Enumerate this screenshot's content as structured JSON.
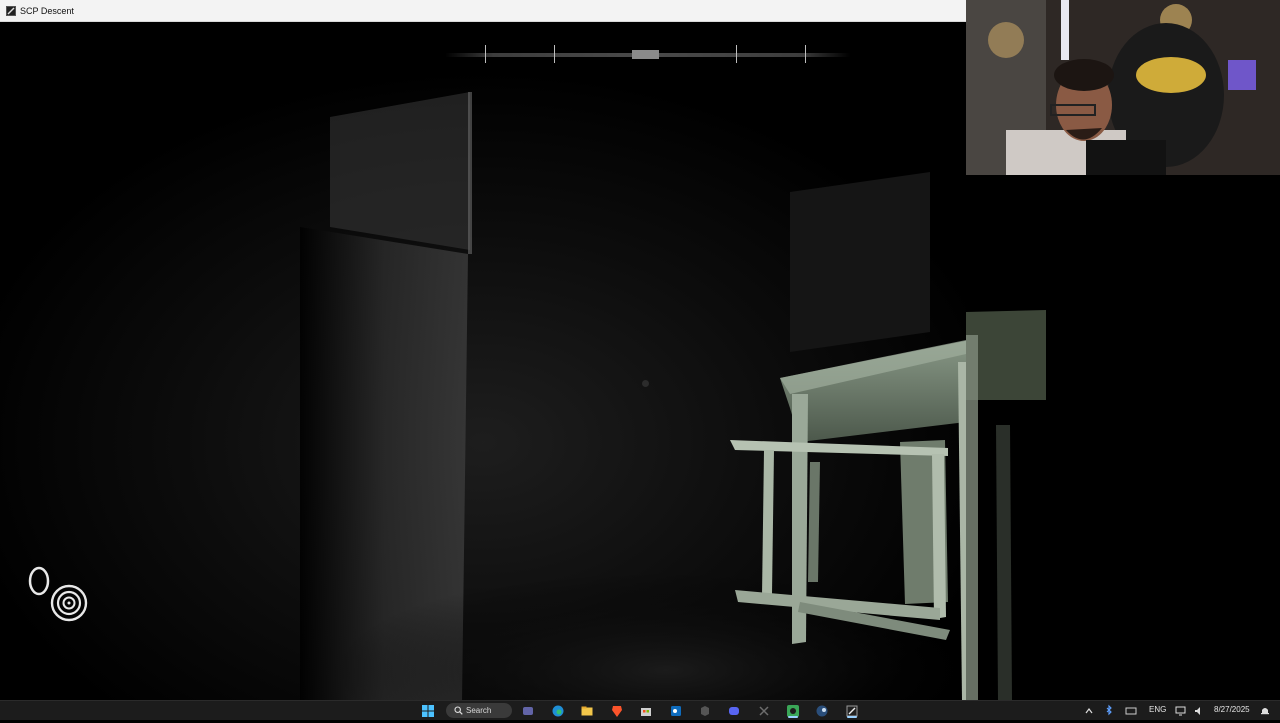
{
  "window": {
    "title": "SCP Descent"
  },
  "hud": {
    "compass_ticks": 4,
    "icons": [
      "stamina-icon",
      "sanity-spiral-icon"
    ]
  },
  "taskbar": {
    "search_label": "Search",
    "language": "ENG",
    "date": "8/27/2025",
    "pinned_icons": [
      "start-icon",
      "search-icon",
      "teams-icon",
      "edge-icon",
      "file-explorer-icon",
      "brave-icon",
      "store-icon",
      "outlook-icon",
      "app-icon",
      "discord-icon",
      "capture-icon",
      "obs-icon",
      "steam-icon",
      "game-icon"
    ],
    "tray_icons": [
      "chevron-up-icon",
      "bluetooth-icon",
      "keyboard-icon",
      "network-icon",
      "volume-icon",
      "notification-icon"
    ]
  },
  "colors": {
    "taskbar_bg": "#1c1c1c",
    "titlebar_bg": "#f3f3f3",
    "accent": "#9ad1ff"
  }
}
